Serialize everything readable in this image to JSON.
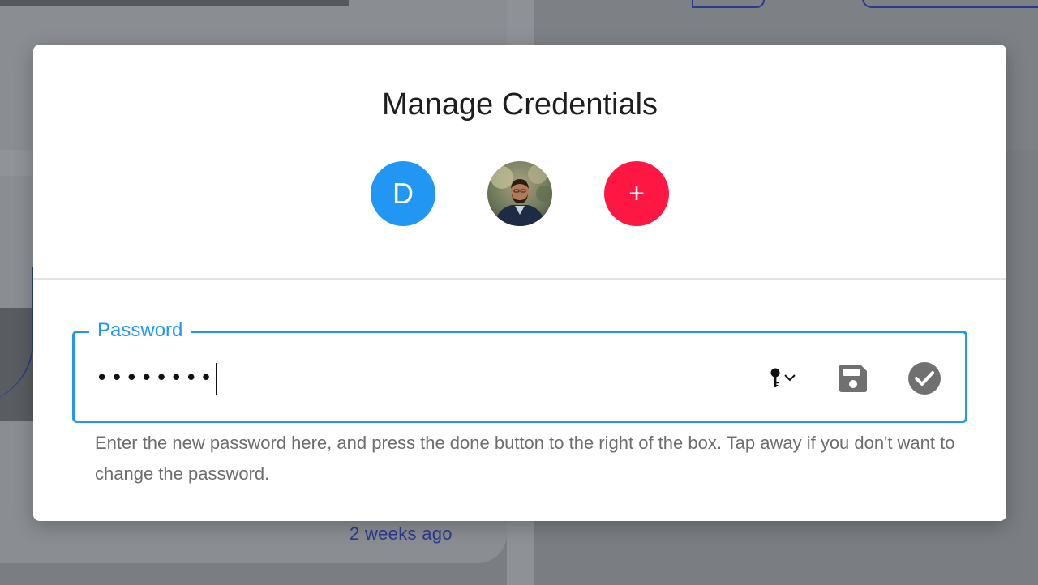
{
  "background": {
    "timestamp": "2 weeks ago"
  },
  "modal": {
    "title": "Manage Credentials",
    "avatars": [
      {
        "initial": "D",
        "color": "#2196f3"
      },
      {
        "type": "photo"
      },
      {
        "symbol": "+",
        "color": "#ff1744"
      }
    ],
    "password_field": {
      "label": "Password",
      "value": "••••••••",
      "icons": [
        "key-dropdown-icon",
        "save-icon",
        "check-circle-icon"
      ]
    },
    "helper_text": "Enter the new password here, and press the done button to the right of the box. Tap away if you don't want to change the password."
  },
  "colors": {
    "accent": "#2196f3",
    "add_button": "#ff1744",
    "background_link": "#2b3a8f"
  }
}
